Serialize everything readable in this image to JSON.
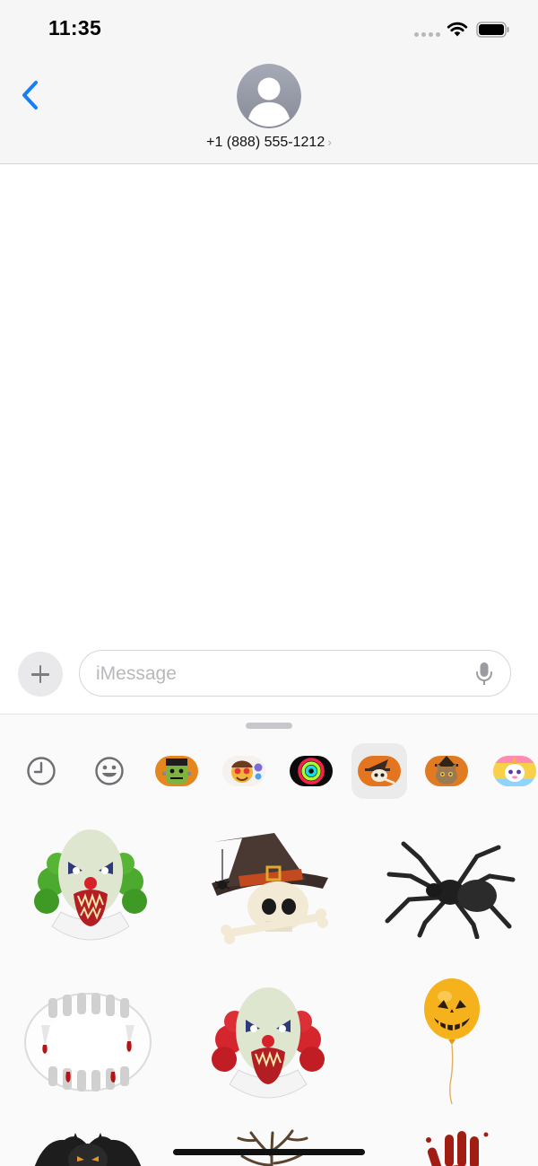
{
  "status_bar": {
    "time": "11:35",
    "icons": [
      "signal-dots-icon",
      "wifi-icon",
      "battery-icon"
    ]
  },
  "header": {
    "back_icon": "chevron-left-icon",
    "avatar_icon": "person-placeholder-icon",
    "contact_name": "+1 (888) 555-1212",
    "contact_chevron": "›"
  },
  "compose": {
    "plus_icon": "plus-icon",
    "placeholder": "iMessage",
    "value": "",
    "mic_icon": "microphone-icon"
  },
  "app_drawer": {
    "apps": [
      {
        "name": "recents",
        "icon": "clock-icon",
        "selected": false
      },
      {
        "name": "memoji",
        "icon": "smiley-icon",
        "selected": false
      },
      {
        "name": "frankenstein-stickers",
        "icon": "frankenstein-icon",
        "selected": false
      },
      {
        "name": "emoji-stickers",
        "icon": "emoji-face-icon",
        "selected": false
      },
      {
        "name": "activity",
        "icon": "activity-rings-icon",
        "selected": false
      },
      {
        "name": "halloween-stickers",
        "icon": "witch-hat-skull-icon",
        "selected": true
      },
      {
        "name": "cat-stickers",
        "icon": "witch-cat-icon",
        "selected": false
      },
      {
        "name": "unicorn-stickers",
        "icon": "unicorn-icon",
        "selected": false
      }
    ],
    "stickers": [
      {
        "name": "green-hair-clown-sticker"
      },
      {
        "name": "witch-hat-skull-sticker"
      },
      {
        "name": "tarantula-sticker"
      },
      {
        "name": "vampire-fangs-sticker"
      },
      {
        "name": "red-hair-clown-sticker"
      },
      {
        "name": "pumpkin-balloon-sticker"
      },
      {
        "name": "bat-sticker"
      },
      {
        "name": "dead-branch-sticker"
      },
      {
        "name": "bloody-handprint-sticker"
      }
    ]
  },
  "colors": {
    "accent": "#147efb",
    "bar_background": "#f6f6f6",
    "drawer_background": "#fafafa"
  }
}
